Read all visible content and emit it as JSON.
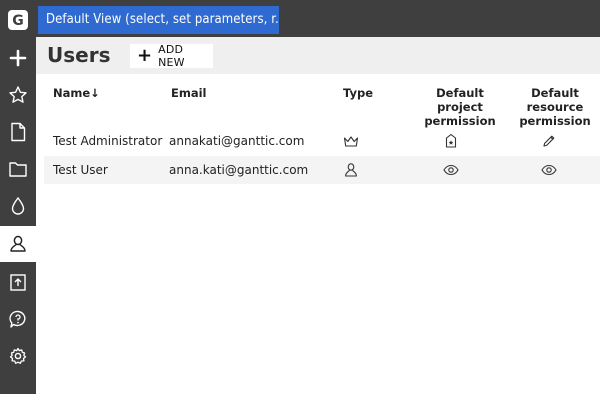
{
  "app": {
    "logo_letter": "G"
  },
  "topbar": {
    "view_title": "Default View (select, set parameters, r..."
  },
  "header": {
    "title": "Users",
    "add_button_label": "ADD NEW",
    "add_button_symbol": "+"
  },
  "table": {
    "columns": {
      "name": "Name↓",
      "email": "Email",
      "type": "Type",
      "project_perm_line1": "Default",
      "project_perm_line2": "project",
      "project_perm_line3": "permission",
      "resource_perm_line1": "Default",
      "resource_perm_line2": "resource",
      "resource_perm_line3": "permission"
    },
    "rows": [
      {
        "name": "Test Administrator",
        "email": "annakati@ganttic.com",
        "type_icon": "crown-icon",
        "project_icon": "badge-star-icon",
        "resource_icon": "pencil-icon"
      },
      {
        "name": "Test User",
        "email": "anna.kati@ganttic.com",
        "type_icon": "user-icon",
        "project_icon": "eye-icon",
        "resource_icon": "eye-icon"
      }
    ]
  },
  "sidebar": {
    "items": [
      {
        "name": "plus-icon"
      },
      {
        "name": "star-icon"
      },
      {
        "name": "document-icon"
      },
      {
        "name": "folder-icon"
      },
      {
        "name": "drop-icon"
      },
      {
        "name": "user-icon",
        "active": true
      },
      {
        "name": "export-icon"
      },
      {
        "name": "help-icon"
      },
      {
        "name": "gear-icon"
      }
    ]
  },
  "colors": {
    "sidebar": "#3f3f3f",
    "accent": "#2f6ad0",
    "header_bg": "#efefef"
  }
}
